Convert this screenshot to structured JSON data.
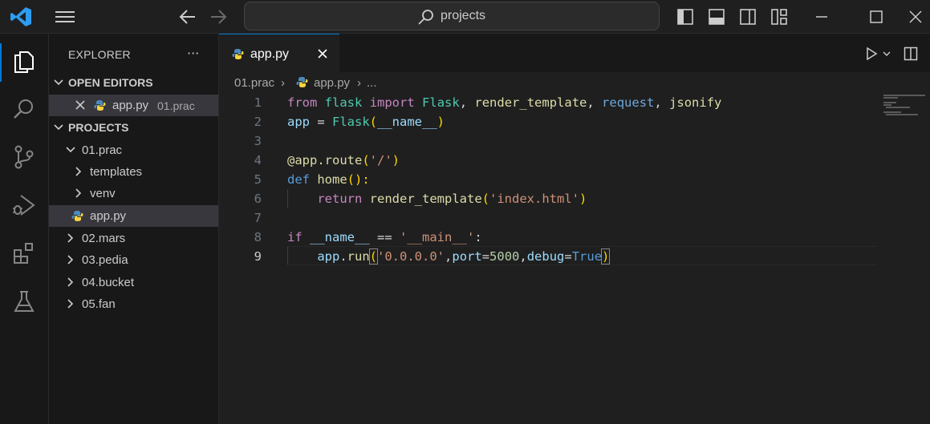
{
  "title_bar": {
    "search_text": "projects"
  },
  "explorer": {
    "title": "EXPLORER",
    "more": "···",
    "open_editors": {
      "header": "OPEN EDITORS",
      "items": [
        {
          "name": "app.py",
          "folder": "01.prac"
        }
      ]
    },
    "projects": {
      "header": "PROJECTS",
      "folder_open": "01.prac",
      "children": [
        "templates",
        "venv",
        "app.py"
      ],
      "other_folders": [
        "02.mars",
        "03.pedia",
        "04.bucket",
        "05.fan"
      ]
    }
  },
  "editor": {
    "tab_label": "app.py",
    "breadcrumb": [
      "01.prac",
      "app.py",
      "..."
    ],
    "line_numbers": [
      "1",
      "2",
      "3",
      "4",
      "5",
      "6",
      "7",
      "8",
      "9"
    ],
    "code": {
      "l1": {
        "from": "from",
        "mod": "flask",
        "imp": "import",
        "a": "Flask",
        "c1": ", ",
        "b": "render_template",
        "c2": ", ",
        "c": "request",
        "c3": ", ",
        "d": "jsonify"
      },
      "l2": {
        "a": "app",
        "eq": " = ",
        "cls": "Flask",
        "p1": "(",
        "arg": "__name__",
        "p2": ")"
      },
      "l4": {
        "dec": "@app.route",
        "p1": "(",
        "s": "'/'",
        "p2": ")"
      },
      "l5": {
        "kw": "def",
        "fn": "home",
        "p": "():"
      },
      "l6": {
        "kw": "return",
        "fn": "render_template",
        "p1": "(",
        "s": "'index.html'",
        "p2": ")"
      },
      "l8": {
        "kw": "if",
        "a": "__name__",
        "op": " == ",
        "s": "'__main__'",
        "c": ":"
      },
      "l9": {
        "obj": "app",
        "dot": ".",
        "fn": "run",
        "p1": "(",
        "s": "'0.0.0.0'",
        "c1": ",",
        "k1": "port",
        "e1": "=",
        "n": "5000",
        "c2": ",",
        "k2": "debug",
        "e2": "=",
        "t": "True",
        "p2": ")"
      }
    }
  },
  "colors": {
    "accent": "#0078d4",
    "keyword": "#c586c0",
    "string": "#ce9178"
  }
}
